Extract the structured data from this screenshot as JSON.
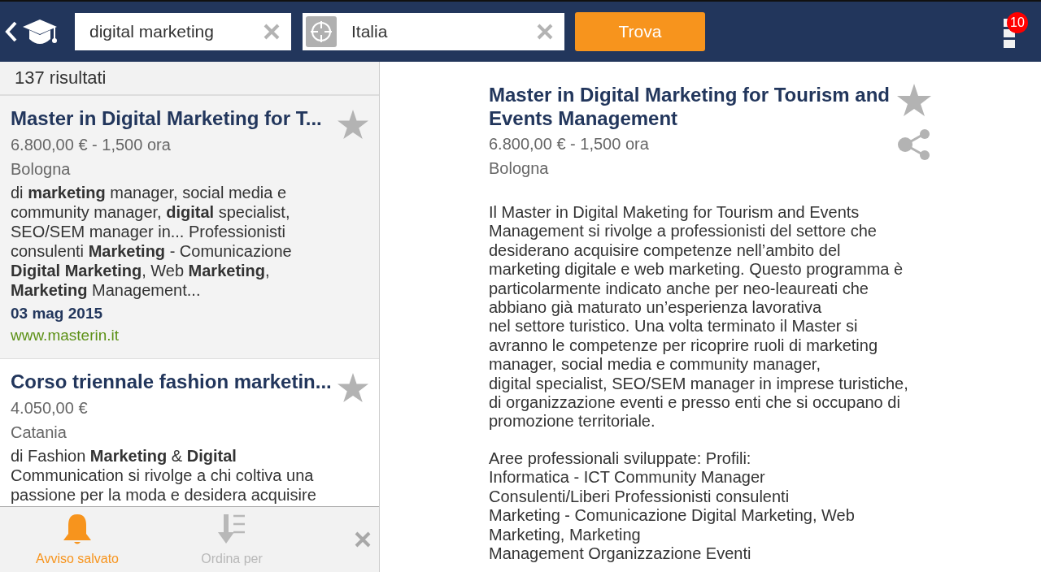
{
  "toolbar": {
    "search": {
      "value": "digital marketing"
    },
    "location": {
      "value": "Italia"
    },
    "search_button": "Trova",
    "notifications_badge": "10"
  },
  "results": {
    "count": "137 risultati",
    "items": [
      {
        "title": "Master in Digital Marketing for T...",
        "selected": true,
        "price": "6.800,00 € - 1,500 ora",
        "city": "Bologna",
        "snippet": "di **marketing** manager, social media e\ncommunity manager, **digital** specialist,\nSEO/SEM manager in... Professionisti\nconsulenti **Marketing** - Comunicazione\n**Digital Marketing**, Web **Marketing**,\n**Marketing** Management...",
        "date": "03 mag 2015",
        "site": "www.masterin.it"
      },
      {
        "title": "Corso triennale fashion marketin...",
        "selected": false,
        "price": "4.050,00 €",
        "city": "Catania",
        "snippet": "di Fashion **Marketing** & **Digital**\nCommunication si rivolge a chi coltiva una\npassione per la moda e desidera acquisire"
      }
    ]
  },
  "bottom_bar": [
    {
      "kind": "alert",
      "label": "Avviso salvato",
      "on": true
    },
    {
      "kind": "sort",
      "label": "Ordina per",
      "on": false
    },
    {
      "kind": "close"
    }
  ],
  "detail": {
    "title": "Master in Digital Marketing for Tourism and\nEvents Management",
    "price": "6.800,00 € - 1,500 ora",
    "city": "Bologna",
    "paragraphs": [
      "Il Master in Digital Maketing for Tourism and Events\nManagement si rivolge a professionisti del settore che\ndesiderano acquisire competenze nell’ambito del\nmarketing digitale e web marketing. Questo programma è\nparticolarmente indicato anche per neo-leaureati che\nabbiano già maturato un’esperienza lavorativa\nnel settore turistico. Una volta terminato il Master si\navranno le competenze per ricoprire ruoli di marketing\nmanager, social media e community manager,\ndigital specialist, SEO/SEM manager in imprese turistiche,\ndi organizzazione eventi e presso enti che si occupano di\npromozione territoriale.",
      "Aree professionali sviluppate: Profili:\nInformatica - ICT Community Manager\nConsulenti/Liberi Professionisti consulenti\nMarketing - Comunicazione Digital Marketing, Web\nMarketing, Marketing\nManagement Organizzazione Eventi"
    ]
  }
}
